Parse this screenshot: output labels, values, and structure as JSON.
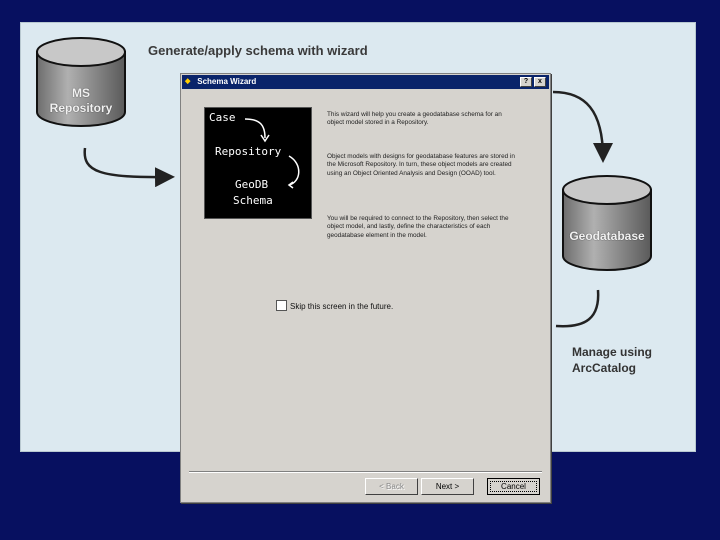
{
  "slide": {
    "heading": "Generate/apply schema with wizard",
    "source_cylinder": "MS\nRepository",
    "target_cylinder": "Geodatabase",
    "manage_note": "Manage using\nArcCatalog"
  },
  "dialog": {
    "title": "Schema Wizard",
    "help_button": "?",
    "close_button": "x",
    "art": {
      "case": "Case",
      "repository": "Repository",
      "geodb": "GeoDB",
      "schema": "Schema"
    },
    "paragraphs": [
      "This wizard will help you create a geodatabase schema for an object model stored in a Repository.",
      "Object models with designs for geodatabase features are stored in the Microsoft Repository. In turn, these object models are created using an Object Oriented Analysis and Design (OOAD) tool.",
      "You will be required to connect to the Repository, then select the object model, and lastly, define the characteristics of each geodatabase element in the model."
    ],
    "skip_label": "Skip this screen in the future.",
    "back_button": "< Back",
    "next_button": "Next >",
    "cancel_button": "Cancel"
  },
  "colors": {
    "background": "#071060",
    "panel": "#dce9f0",
    "cylinder": "#9a9a9a",
    "titlebar": "#0a246a"
  },
  "icons": [
    "arrow-icon",
    "cylinder-icon",
    "wizard-icon"
  ]
}
